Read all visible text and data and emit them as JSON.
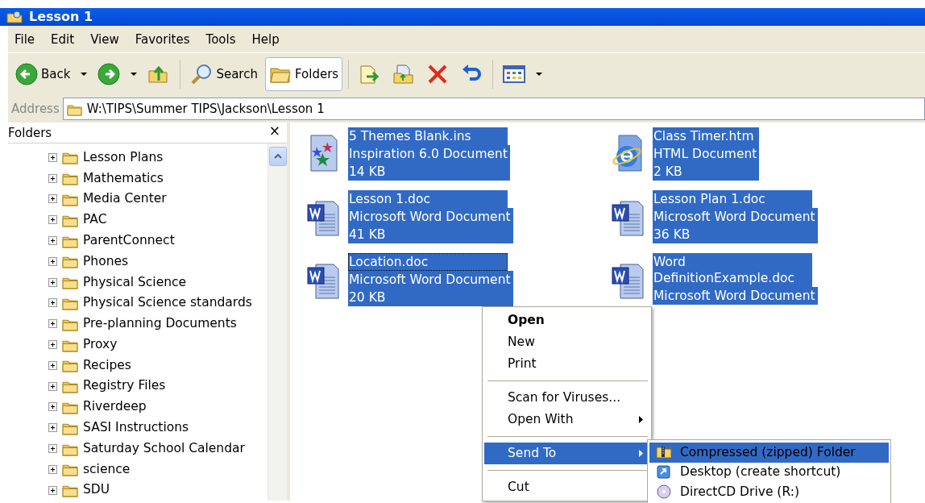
{
  "window": {
    "title": "Lesson 1"
  },
  "menu_bar": [
    "File",
    "Edit",
    "View",
    "Favorites",
    "Tools",
    "Help"
  ],
  "toolbar": [
    {
      "kind": "back",
      "label": "Back",
      "pressed": false
    },
    {
      "kind": "forward",
      "pressed": false
    },
    {
      "kind": "up",
      "pressed": false
    },
    {
      "kind": "search",
      "label": "Search",
      "pressed": false
    },
    {
      "kind": "folders",
      "label": "Folders",
      "pressed": true
    },
    {
      "kind": "move",
      "pressed": false
    },
    {
      "kind": "copy",
      "pressed": false
    },
    {
      "kind": "delete",
      "pressed": false
    },
    {
      "kind": "undo",
      "pressed": false
    },
    {
      "kind": "views",
      "pressed": false
    }
  ],
  "address": {
    "label": "Address",
    "value": "W:\\TIPS\\Summer TIPS\\Jackson\\Lesson 1"
  },
  "folders_pane": {
    "title": "Folders",
    "close": "×",
    "items": [
      {
        "label": "Lesson Plans",
        "expanded": false
      },
      {
        "label": "Mathematics",
        "expanded": false
      },
      {
        "label": "Media Center",
        "expanded": false
      },
      {
        "label": "PAC",
        "expanded": false
      },
      {
        "label": "ParentConnect",
        "expanded": false
      },
      {
        "label": "Phones",
        "expanded": false
      },
      {
        "label": "Physical Science",
        "expanded": false
      },
      {
        "label": "Physical Science standards",
        "expanded": false
      },
      {
        "label": "Pre-planning Documents",
        "expanded": false
      },
      {
        "label": "Proxy",
        "expanded": false
      },
      {
        "label": "Recipes",
        "expanded": false
      },
      {
        "label": "Registry Files",
        "expanded": false
      },
      {
        "label": "Riverdeep",
        "expanded": false
      },
      {
        "label": "SASI Instructions",
        "expanded": false
      },
      {
        "label": "Saturday School Calendar",
        "expanded": false
      },
      {
        "label": "science",
        "expanded": false
      },
      {
        "label": "SDU",
        "expanded": false
      }
    ]
  },
  "files": [
    {
      "kind": "inspiration",
      "name": "5 Themes Blank.ins",
      "type": "Inspiration 6.0 Document",
      "size": "14 KB",
      "selected": true,
      "focused": false
    },
    {
      "kind": "html",
      "name": "Class Timer.htm",
      "type": "HTML Document",
      "size": "2 KB",
      "selected": true,
      "focused": false
    },
    {
      "kind": "word",
      "name": "Lesson 1.doc",
      "type": "Microsoft Word Document",
      "size": "41 KB",
      "selected": true,
      "focused": false
    },
    {
      "kind": "word",
      "name": "Lesson Plan 1.doc",
      "type": "Microsoft Word Document",
      "size": "36 KB",
      "selected": true,
      "focused": false
    },
    {
      "kind": "word",
      "name": "Location.doc",
      "type": "Microsoft Word Document",
      "size": "20 KB",
      "selected": true,
      "focused": true
    },
    {
      "kind": "word",
      "name": "Word DefinitionExample.doc",
      "type": "Microsoft Word Document",
      "selected": true,
      "focused": false
    }
  ],
  "context_menu": [
    {
      "kind": "item",
      "label": "Open",
      "default": true,
      "submenu": false,
      "selected": false
    },
    {
      "kind": "item",
      "label": "New",
      "default": false,
      "submenu": false,
      "selected": false
    },
    {
      "kind": "item",
      "label": "Print",
      "default": false,
      "submenu": false,
      "selected": false
    },
    {
      "kind": "separator"
    },
    {
      "kind": "item",
      "label": "Scan for Viruses...",
      "default": false,
      "submenu": false,
      "selected": false
    },
    {
      "kind": "item",
      "label": "Open With",
      "default": false,
      "submenu": true,
      "selected": false
    },
    {
      "kind": "separator"
    },
    {
      "kind": "item",
      "label": "Send To",
      "default": false,
      "submenu": true,
      "selected": true
    },
    {
      "kind": "separator"
    },
    {
      "kind": "item",
      "label": "Cut",
      "default": false,
      "submenu": false,
      "selected": false
    }
  ],
  "send_to_menu": [
    {
      "kind": "zip",
      "label": "Compressed (zipped) Folder",
      "selected": true
    },
    {
      "kind": "desktop",
      "label": "Desktop (create shortcut)",
      "selected": false
    },
    {
      "kind": "drive",
      "label": "DirectCD Drive (R:)",
      "selected": false
    }
  ]
}
